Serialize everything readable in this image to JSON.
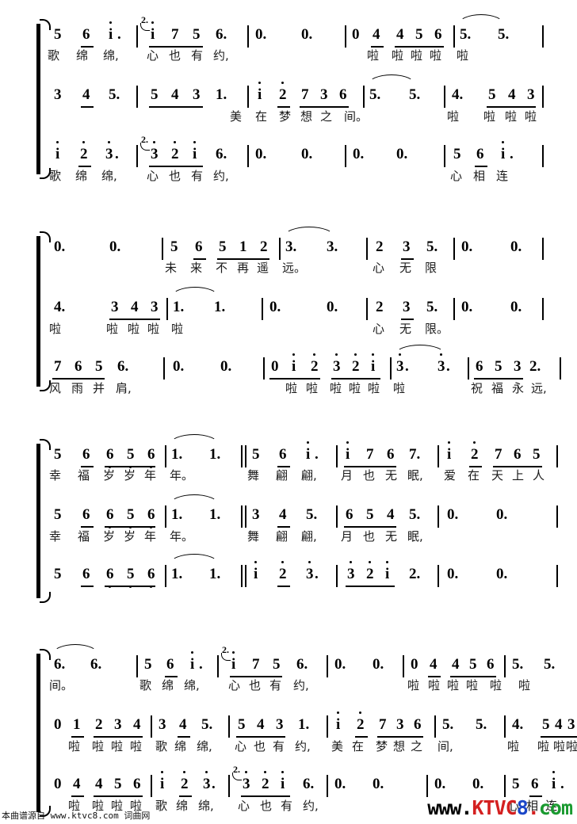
{
  "document": {
    "type": "jianpu-score",
    "title_visible": false,
    "source_note": "本曲谱源自 www.ktvc8.com 词曲网",
    "watermark": {
      "parts": [
        {
          "text": "www.",
          "color": "#000000"
        },
        {
          "text": "KTVC",
          "color": "#d42020"
        },
        {
          "text": "8",
          "color": "#1a46c8"
        },
        {
          "text": ".",
          "color": "#d42020"
        },
        {
          "text": "com",
          "color": "#1a9a30"
        }
      ]
    }
  },
  "systems": [
    {
      "id": "system-1",
      "staves": [
        {
          "id": "s1-voice1",
          "notes": "5 6 i. | 2.(i) 7 5 6. | 0. 0. | 0 4 4 5 6 | 5. 5. |",
          "lyrics": "歌 绵 绵, 心 也 有 约, 啦 啦啦啦 啦"
        },
        {
          "id": "s1-voice2",
          "notes": "3 4 5. | 5 4 3 1. | i 2 7 3 6 | 5. 5. | 4. 5 4 3 |",
          "lyrics": "美 在 梦 想 之 间。 啦 啦啦啦"
        },
        {
          "id": "s1-voice3",
          "notes": "i 2 3. | 2.(3) 2 i 6. | 0. 0. | 0. 0. | 5 6 i. |",
          "lyrics": "歌 绵 绵, 心 也 有 约, 心 相 连"
        }
      ]
    },
    {
      "id": "system-2",
      "staves": [
        {
          "id": "s2-voice1",
          "notes": "0. 0. | 5 6 5 1 2 | 3. 3. | 2 3 5. | 0. 0. |",
          "lyrics": "未 来 不 再 遥 远。 心 无 限"
        },
        {
          "id": "s2-voice2",
          "notes": "4. 3 4 3 | 1. 1. | 0. 0. | 2 3 5. | 0. 0. |",
          "lyrics": "啦 啦啦啦 啦 心 无 限。"
        },
        {
          "id": "s2-voice3",
          "notes": "7 6 5 6. | 0. 0. | 0 i 2 3 2 i | 3. 3. | 6 5 3 2. |",
          "lyrics": "风 雨 并 肩, 啦啦 啦啦啦 啦 祝 福 永 远,"
        }
      ]
    },
    {
      "id": "system-3",
      "staves": [
        {
          "id": "s3-voice1",
          "notes": "5 6 6 5 6 | 1. 1. || 5 6 i. | i 7 6 7. | i 2 7 6 5 |",
          "lyrics": "幸 福 岁 岁 年 年。 舞 翩 翩, 月 也 无 眠, 爱 在 天 上 人"
        },
        {
          "id": "s3-voice2",
          "notes": "5 6 6 5 6 | 1. 1. || 3 4 5. | 6 5 4 5. | 0. 0. |",
          "lyrics": "幸 福 岁 岁 年 年。 舞 翩 翩, 月 也 无 眠,"
        },
        {
          "id": "s3-voice3",
          "notes": "5 6 6 5 6 | 1. 1. || i 2 3. | 3 2 i 2. | 0. 0. |",
          "lyrics": ""
        }
      ]
    },
    {
      "id": "system-4",
      "staves": [
        {
          "id": "s4-voice1",
          "notes": "6. 6. | 5 6 i. | 2.(i) 7 5 6. | 0. 0. | 0 4 4 5 6 | 5. 5. |",
          "lyrics": "间。 歌 绵 绵, 心 也 有 约, 啦 啦啦啦 啦 啦"
        },
        {
          "id": "s4-voice2",
          "notes": "0 1 2 3 4 | 3 4 5. | 5 4 3 1. | i 2 7 3 6 | 5. 5. | 4. 5 4 3 |",
          "lyrics": "啦 啦啦啦 歌绵 绵, 心也有 约, 美在 梦想之 间, 啦 啦啦啦"
        },
        {
          "id": "s4-voice3",
          "notes": "0 4 4 5 6 | i 2 3. | 2.(3) 2 i 6. | 0. 0. | 0. 0. | 5 6 i. |",
          "lyrics": "啦 啦啦啦 歌绵 绵, 心 也 有 约, 心相连"
        }
      ]
    }
  ],
  "glyphs": {
    "ending2": "2.",
    "rest": "0",
    "dot": ".",
    "digits": [
      "1",
      "2",
      "3",
      "4",
      "5",
      "6",
      "7",
      "i"
    ]
  },
  "colors": {
    "ink": "#000000",
    "lyric": "#1a1a1a",
    "wm_red": "#d42020",
    "wm_blue": "#1a46c8",
    "wm_green": "#1a9a30"
  }
}
